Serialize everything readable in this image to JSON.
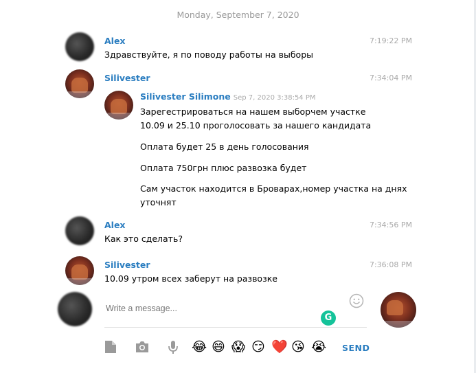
{
  "date_separator": "Monday, September 7, 2020",
  "messages": [
    {
      "author": "Alex",
      "time": "7:19:22 PM",
      "text": "Здравствуйте, я по поводу работы на выборы"
    },
    {
      "author": "Silivester",
      "time": "7:34:04 PM",
      "forwarded": {
        "author": "Silivester Silimone",
        "date": "Sep 7, 2020 3:38:54 PM",
        "lines": [
          "Зарегестрироваться на нашем выборчем участке",
          "10.09 и 25.10 проголосовать за нашего кандидата",
          "Оплата будет 25 в день голосования",
          "Оплата 750грн плюс развозка будет",
          "Сам участок находится в Броварах,номер участка на днях",
          "уточнят"
        ]
      }
    },
    {
      "author": "Alex",
      "time": "7:34:56 PM",
      "text": "Как это сделать?"
    },
    {
      "author": "Silivester",
      "time": "7:36:08 PM",
      "text": "10.09 утром всех заберут на развозке"
    }
  ],
  "composer": {
    "placeholder": "Write a message...",
    "send_label": "SEND",
    "grammarly_badge": "G"
  },
  "toolbar": {
    "icons": [
      "document-icon",
      "camera-icon",
      "microphone-icon"
    ],
    "emojis": [
      "😂",
      "😄",
      "😱",
      "😏",
      "❤️",
      "😘",
      "😭"
    ]
  },
  "colors": {
    "accent": "#2a7dc0",
    "time": "#a8a8a8",
    "grammarly": "#15c39a"
  }
}
